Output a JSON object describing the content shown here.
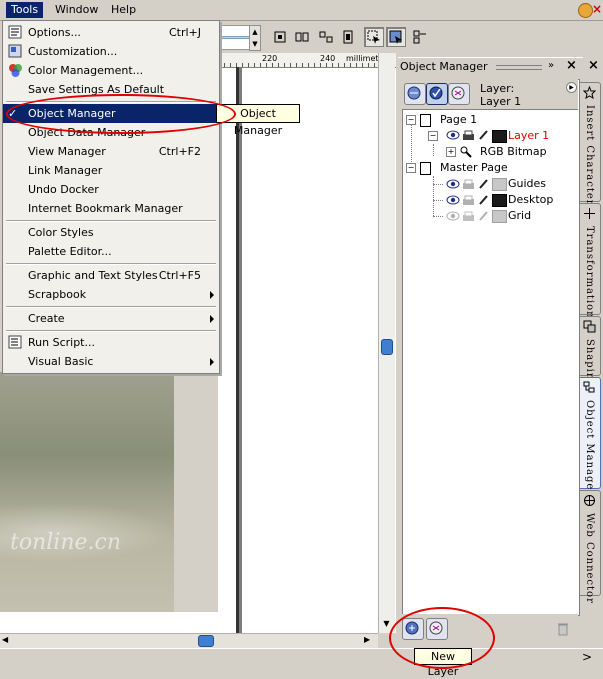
{
  "menubar": {
    "items": [
      {
        "label": "Tools",
        "active": true
      },
      {
        "label": "Window"
      },
      {
        "label": "Help"
      }
    ]
  },
  "ruler": {
    "tick1": "220",
    "tick2": "240",
    "unit": "millimeters"
  },
  "tools_menu": {
    "items": [
      {
        "label": "Options...",
        "shortcut": "Ctrl+J",
        "icon": "options-icon"
      },
      {
        "label": "Customization...",
        "icon": "customization-icon"
      },
      {
        "label": "Color Management...",
        "icon": "color-management-icon"
      },
      {
        "label": "Save Settings As Default"
      },
      {
        "label": "Object Manager",
        "highlighted": true,
        "checked": true
      },
      {
        "label": "Object Data Manager"
      },
      {
        "label": "View Manager",
        "shortcut": "Ctrl+F2"
      },
      {
        "label": "Link Manager"
      },
      {
        "label": "Undo Docker"
      },
      {
        "label": "Internet Bookmark Manager"
      },
      {
        "label": "Color Styles"
      },
      {
        "label": "Palette Editor..."
      },
      {
        "label": "Graphic and Text Styles",
        "shortcut": "Ctrl+F5"
      },
      {
        "label": "Scrapbook",
        "submenu": true
      },
      {
        "label": "Create",
        "submenu": true
      },
      {
        "label": "Run Script...",
        "icon": "run-script-icon"
      },
      {
        "label": "Visual Basic",
        "submenu": true
      }
    ]
  },
  "tooltip_menu": "Object Manager",
  "photo": {
    "watermark": "tonline.cn"
  },
  "docker": {
    "title": "Object Manager",
    "layer_label": "Layer:",
    "layer_name": "Layer 1",
    "tree": {
      "page1": "Page 1",
      "layer1": "Layer 1",
      "bitmap": "RGB Bitmap",
      "master": "Master Page",
      "guides": "Guides",
      "desktop": "Desktop",
      "grid": "Grid"
    },
    "colors": {
      "layer1": "#1a1a1a",
      "guides": "#c8c8c8",
      "desktop": "#1a1a1a",
      "grid": "#c8c8c8",
      "active_layer_text": "#e00000"
    },
    "tabs": [
      {
        "label": "Insert Character"
      },
      {
        "label": "Transformation"
      },
      {
        "label": "Shaping"
      },
      {
        "label": "Object Manager",
        "active": true
      },
      {
        "label": "Web Connector"
      }
    ],
    "bottom_tooltip": "New Layer"
  },
  "accent": "#0a246a",
  "annotation_color": "#e00000"
}
